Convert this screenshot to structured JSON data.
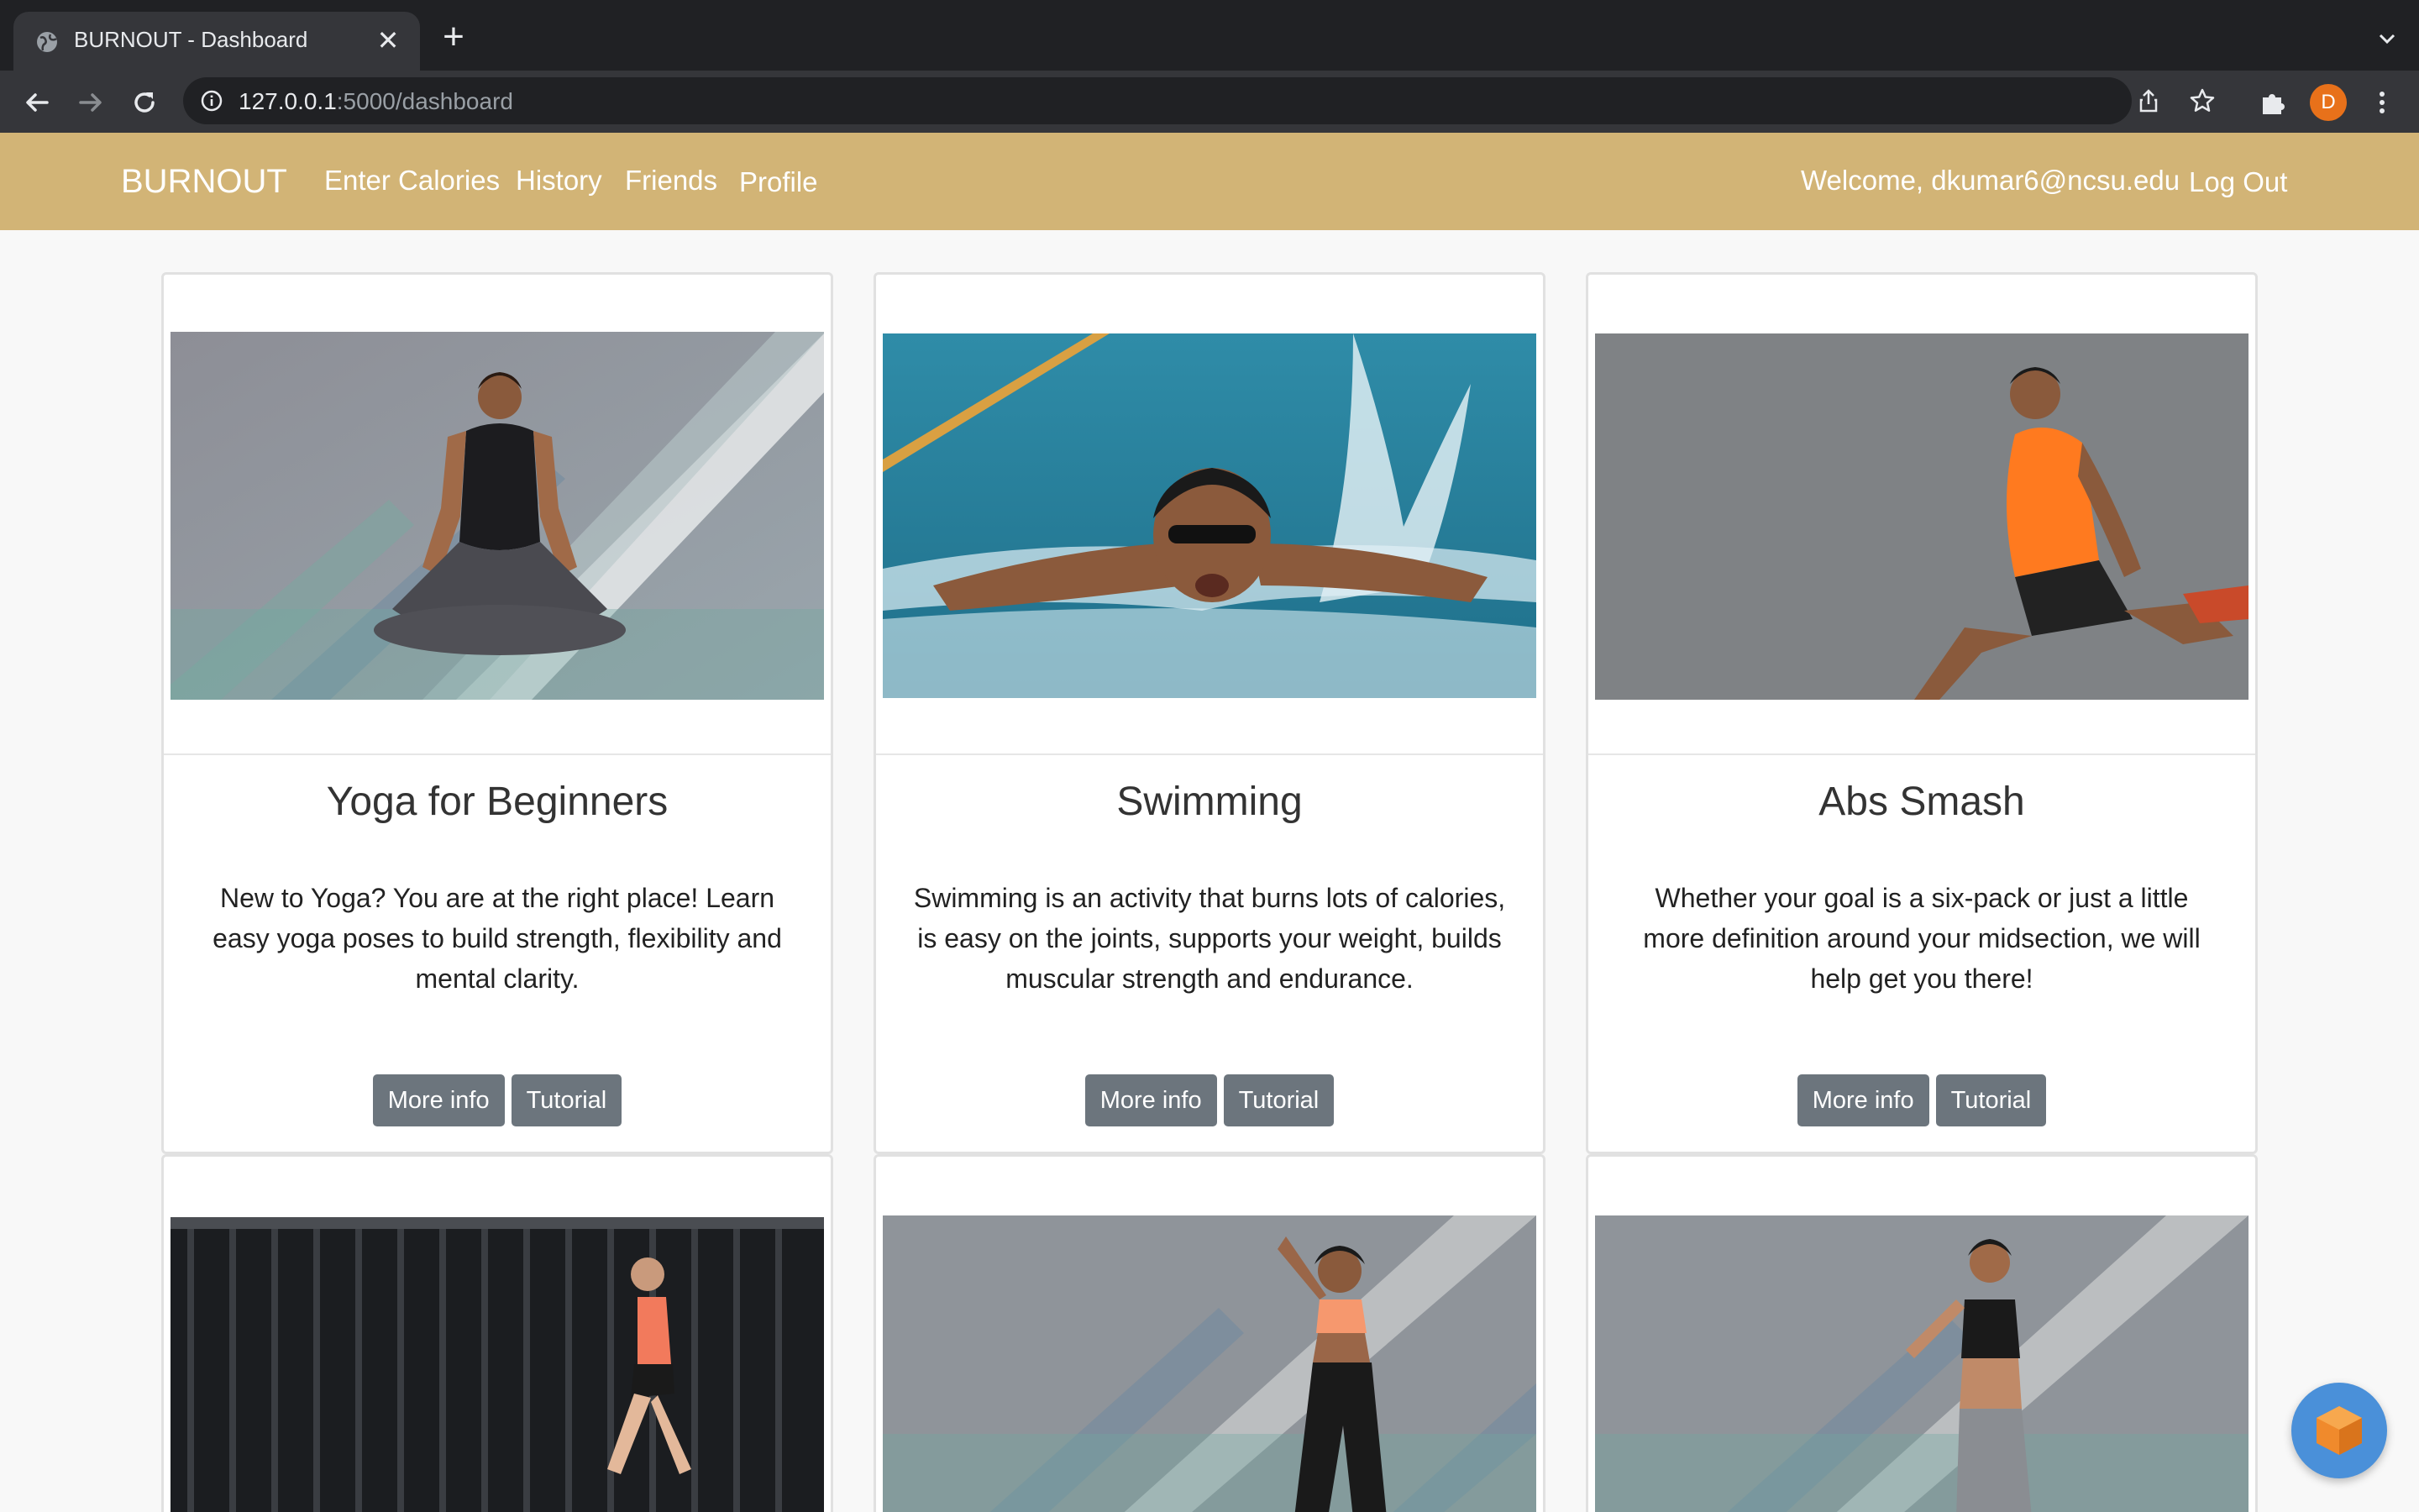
{
  "browser": {
    "tab_title": "BURNOUT - Dashboard",
    "tab_close": "✕",
    "new_tab": "+",
    "url_host": "127.0.0.1",
    "url_path": ":5000/dashboard",
    "profile_initial": "D"
  },
  "nav": {
    "brand": "BURNOUT",
    "links": [
      "Enter Calories",
      "History",
      "Friends",
      "Profile"
    ],
    "welcome": "Welcome, dkumar6@ncsu.edu",
    "logout": "Log Out",
    "color": "#d2b476"
  },
  "cards": [
    {
      "title": "Yoga for Beginners",
      "text": "New to Yoga? You are at the right place! Learn easy yoga poses to build strength, flexibility and mental clarity.",
      "more_info": "More info",
      "tutorial": "Tutorial",
      "image": "woman-meditating-photo"
    },
    {
      "title": "Swimming",
      "text": "Swimming is an activity that burns lots of calories, is easy on the joints, supports your weight, builds muscular strength and endurance.",
      "more_info": "More info",
      "tutorial": "Tutorial",
      "image": "man-swimming-butterfly-photo"
    },
    {
      "title": "Abs Smash",
      "text": "Whether your goal is a six-pack or just a little more definition around your midsection, we will help get you there!",
      "more_info": "More info",
      "tutorial": "Tutorial",
      "image": "man-stretching-photo"
    },
    {
      "image": "woman-walking-photo"
    },
    {
      "image": "woman-waving-photo"
    },
    {
      "image": "woman-dancing-photo"
    }
  ],
  "colors": {
    "button": "#6c757d",
    "fab": "#4a90d9",
    "avatar": "#e8711a"
  }
}
